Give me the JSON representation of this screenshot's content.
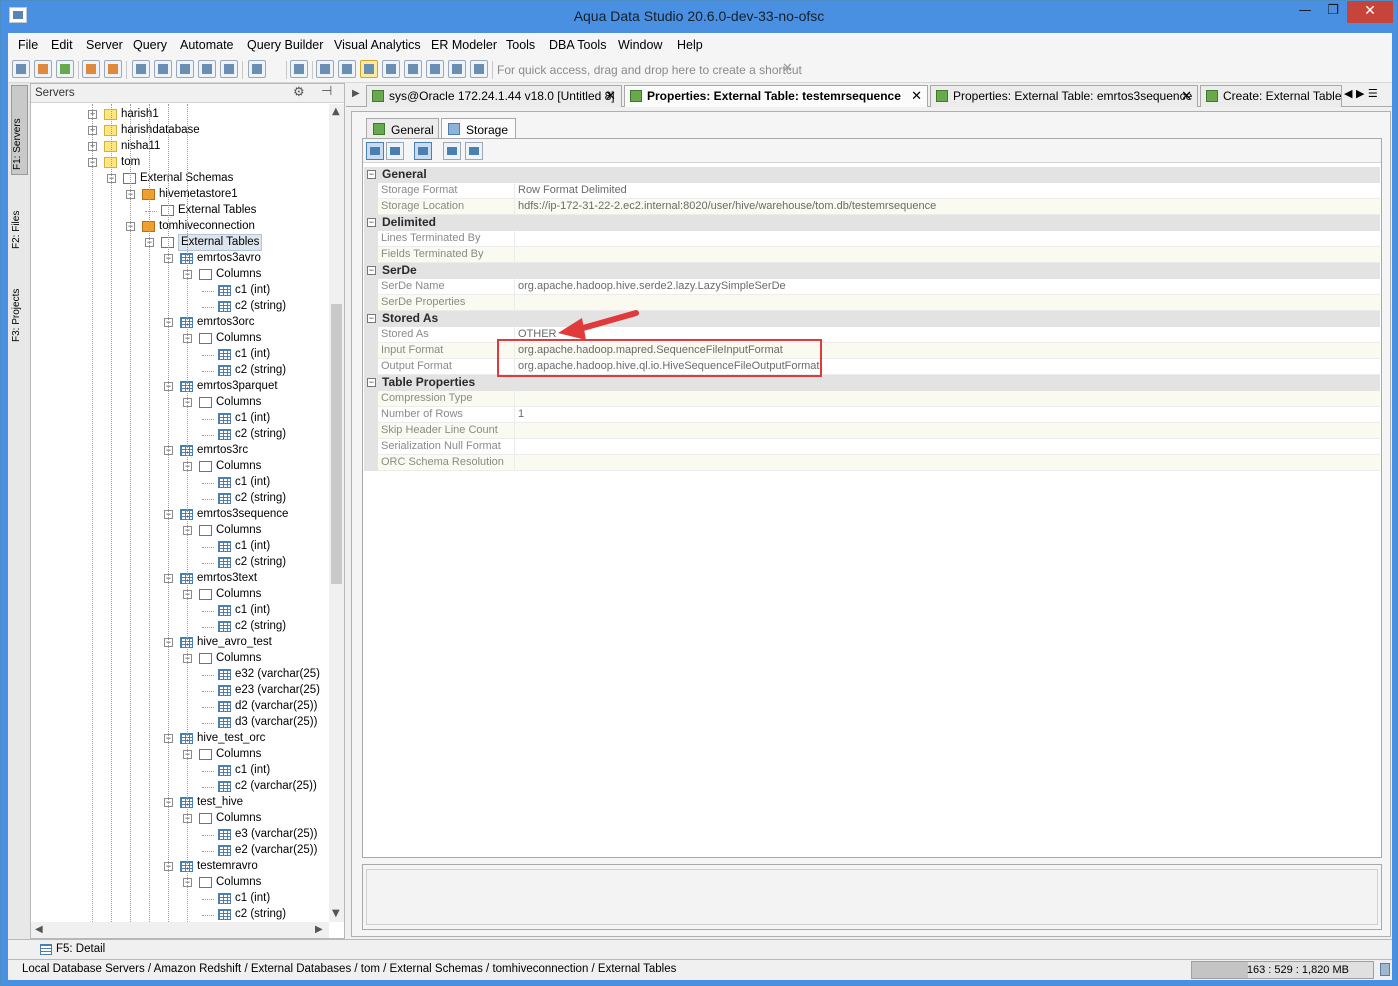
{
  "window": {
    "title": "Aqua Data Studio 20.6.0-dev-33-no-ofsc",
    "minimize": "—",
    "maximize": "❐",
    "close": "✕"
  },
  "menu": [
    "File",
    "Edit",
    "Server",
    "Query",
    "Automate",
    "Query Builder",
    "Visual Analytics",
    "ER Modeler",
    "Tools",
    "DBA Tools",
    "Window",
    "Help"
  ],
  "toolbar": {
    "shortcut_hint": "For quick access, drag and drop here to create a shortcut",
    "shortcut_close": "✕"
  },
  "sidetabs": [
    "F1: Servers",
    "F2: Files",
    "F3: Projects"
  ],
  "servers_panel": {
    "title": "Servers",
    "gear": "⚙",
    "pin": "⊣"
  },
  "tree": [
    {
      "label": "harish1",
      "icon": "db",
      "expander": "+"
    },
    {
      "label": "harishdatabase",
      "icon": "db",
      "expander": "+"
    },
    {
      "label": "nisha11",
      "icon": "db",
      "expander": "+"
    },
    {
      "label": "tom",
      "icon": "db",
      "expander": "−"
    },
    {
      "label": "External Schemas",
      "icon": "folder",
      "expander": "−"
    },
    {
      "label": "hivemetastore1",
      "icon": "conn",
      "expander": "−"
    },
    {
      "label": "External Tables",
      "icon": "folder",
      "expander": ""
    },
    {
      "label": "tomhiveconnection",
      "icon": "conn",
      "expander": "−"
    },
    {
      "label": "External Tables",
      "icon": "folder",
      "expander": "−",
      "selected": true
    },
    {
      "label": "emrtos3avro",
      "icon": "table",
      "expander": "−"
    },
    {
      "label": "Columns",
      "icon": "folder",
      "expander": "−"
    },
    {
      "label": "c1 (int)",
      "icon": "table",
      "expander": ""
    },
    {
      "label": "c2 (string)",
      "icon": "table",
      "expander": ""
    },
    {
      "label": "emrtos3orc",
      "icon": "table",
      "expander": "−"
    },
    {
      "label": "Columns",
      "icon": "folder",
      "expander": "−"
    },
    {
      "label": "c1 (int)",
      "icon": "table",
      "expander": ""
    },
    {
      "label": "c2 (string)",
      "icon": "table",
      "expander": ""
    },
    {
      "label": "emrtos3parquet",
      "icon": "table",
      "expander": "−"
    },
    {
      "label": "Columns",
      "icon": "folder",
      "expander": "−"
    },
    {
      "label": "c1 (int)",
      "icon": "table",
      "expander": ""
    },
    {
      "label": "c2 (string)",
      "icon": "table",
      "expander": ""
    },
    {
      "label": "emrtos3rc",
      "icon": "table",
      "expander": "−"
    },
    {
      "label": "Columns",
      "icon": "folder",
      "expander": "−"
    },
    {
      "label": "c1 (int)",
      "icon": "table",
      "expander": ""
    },
    {
      "label": "c2 (string)",
      "icon": "table",
      "expander": ""
    },
    {
      "label": "emrtos3sequence",
      "icon": "table",
      "expander": "−"
    },
    {
      "label": "Columns",
      "icon": "folder",
      "expander": "−"
    },
    {
      "label": "c1 (int)",
      "icon": "table",
      "expander": ""
    },
    {
      "label": "c2 (string)",
      "icon": "table",
      "expander": ""
    },
    {
      "label": "emrtos3text",
      "icon": "table",
      "expander": "−"
    },
    {
      "label": "Columns",
      "icon": "folder",
      "expander": "−"
    },
    {
      "label": "c1 (int)",
      "icon": "table",
      "expander": ""
    },
    {
      "label": "c2 (string)",
      "icon": "table",
      "expander": ""
    },
    {
      "label": "hive_avro_test",
      "icon": "table",
      "expander": "−"
    },
    {
      "label": "Columns",
      "icon": "folder",
      "expander": "−"
    },
    {
      "label": "e32 (varchar(25)",
      "icon": "table",
      "expander": ""
    },
    {
      "label": "e23 (varchar(25)",
      "icon": "table",
      "expander": ""
    },
    {
      "label": "d2 (varchar(25))",
      "icon": "table",
      "expander": ""
    },
    {
      "label": "d3 (varchar(25))",
      "icon": "table",
      "expander": ""
    },
    {
      "label": "hive_test_orc",
      "icon": "table",
      "expander": "−"
    },
    {
      "label": "Columns",
      "icon": "folder",
      "expander": "−"
    },
    {
      "label": "c1 (int)",
      "icon": "table",
      "expander": ""
    },
    {
      "label": "c2 (varchar(25))",
      "icon": "table",
      "expander": ""
    },
    {
      "label": "test_hive",
      "icon": "table",
      "expander": "−"
    },
    {
      "label": "Columns",
      "icon": "folder",
      "expander": "−"
    },
    {
      "label": "e3 (varchar(25))",
      "icon": "table",
      "expander": ""
    },
    {
      "label": "e2 (varchar(25))",
      "icon": "table",
      "expander": ""
    },
    {
      "label": "testemravro",
      "icon": "table",
      "expander": "−"
    },
    {
      "label": "Columns",
      "icon": "folder",
      "expander": "−"
    },
    {
      "label": "c1 (int)",
      "icon": "table",
      "expander": ""
    },
    {
      "label": "c2 (string)",
      "icon": "table",
      "expander": ""
    }
  ],
  "editor_tabs": [
    {
      "label": "sys@Oracle 172.24.1.44 v18.0 [Untitled 8]",
      "active": false
    },
    {
      "label": "Properties: External Table: testemrsequence",
      "active": true
    },
    {
      "label": "Properties: External Table: emrtos3sequence",
      "active": false
    },
    {
      "label": "Create: External Table",
      "active": false
    }
  ],
  "tab_close": "✕",
  "tab_nav": "◀ ▶ ☰",
  "subtabs": [
    "General",
    "Storage"
  ],
  "properties": [
    {
      "category": "General",
      "props": [
        {
          "name": "Storage Format",
          "value": "Row Format Delimited"
        },
        {
          "name": "Storage Location",
          "value": "hdfs://ip-172-31-22-2.ec2.internal:8020/user/hive/warehouse/tom.db/testemrsequence"
        }
      ]
    },
    {
      "category": "Delimited",
      "props": [
        {
          "name": "Lines Terminated By",
          "value": ""
        },
        {
          "name": "Fields Terminated By",
          "value": ""
        }
      ]
    },
    {
      "category": "SerDe",
      "props": [
        {
          "name": "SerDe Name",
          "value": "org.apache.hadoop.hive.serde2.lazy.LazySimpleSerDe"
        },
        {
          "name": "SerDe Properties",
          "value": ""
        }
      ]
    },
    {
      "category": "Stored As",
      "props": [
        {
          "name": "Stored As",
          "value": "OTHER"
        },
        {
          "name": "Input Format",
          "value": "org.apache.hadoop.mapred.SequenceFileInputFormat"
        },
        {
          "name": "Output Format",
          "value": "org.apache.hadoop.hive.ql.io.HiveSequenceFileOutputFormat"
        }
      ]
    },
    {
      "category": "Table Properties",
      "props": [
        {
          "name": "Compression Type",
          "value": ""
        },
        {
          "name": "Number of Rows",
          "value": "1"
        },
        {
          "name": "Skip Header Line Count",
          "value": ""
        },
        {
          "name": "Serialization Null Format",
          "value": ""
        },
        {
          "name": "ORC Schema Resolution",
          "value": ""
        }
      ]
    }
  ],
  "detail_bar": {
    "label": "F5: Detail"
  },
  "status": {
    "breadcrumb": "Local Database Servers / Amazon Redshift / External Databases / tom / External Schemas / tomhiveconnection / External Tables",
    "memory_text": "163 : 529 : 1,820 MB",
    "memory_used_fraction": 0.31
  },
  "colors": {
    "titlebar": "#4a90e2",
    "close_button": "#c7443b",
    "annotation_red": "#e03a3a"
  }
}
